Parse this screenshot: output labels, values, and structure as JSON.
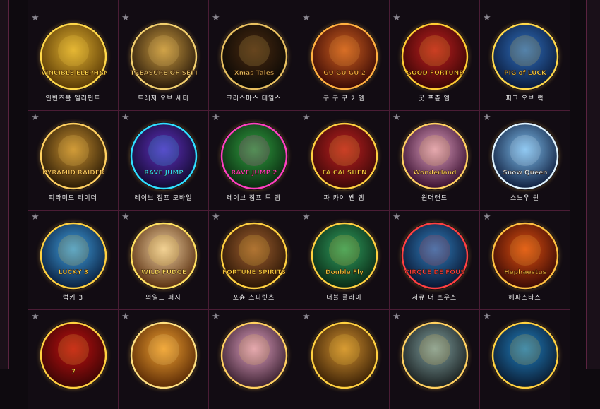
{
  "rows": [
    {
      "games": [
        {
          "name": "",
          "art": "",
          "c1": "#3a2a1a",
          "c2": "#1a1410",
          "accent": "#c9a050"
        },
        {
          "name": "",
          "art": "",
          "c1": "#3a2a1a",
          "c2": "#1a1410",
          "accent": "#c9a050"
        },
        {
          "name": "",
          "art": "",
          "c1": "#3a2a1a",
          "c2": "#1a1410",
          "accent": "#c9a050"
        },
        {
          "name": "",
          "art": "",
          "c1": "#3a2a1a",
          "c2": "#1a1410",
          "accent": "#c9a050"
        },
        {
          "name": "",
          "art": "",
          "c1": "#3a2a1a",
          "c2": "#1a1410",
          "accent": "#c9a050"
        },
        {
          "name": "",
          "art": "",
          "c1": "#3a2a1a",
          "c2": "#1a1410",
          "accent": "#c9a050"
        }
      ]
    },
    {
      "games": [
        {
          "name": "인빈츠블 엘러펀트",
          "art": "INVINCIBLE ELEPHANT",
          "c1": "#e0b030",
          "c2": "#5a3a05",
          "accent": "#ffd84a"
        },
        {
          "name": "트레져 오브 세티",
          "art": "TREASURE OF SETI",
          "c1": "#c99a40",
          "c2": "#2a1a0a",
          "accent": "#f2cf6e"
        },
        {
          "name": "크리스마스 테일스",
          "art": "Xmas Tales",
          "c1": "#4a2a10",
          "c2": "#0a0805",
          "accent": "#e8c060"
        },
        {
          "name": "구 구 구 2 엠",
          "art": "GU GU GU 2",
          "c1": "#d06020",
          "c2": "#3a0a05",
          "accent": "#ffb040"
        },
        {
          "name": "굿 포츈 엠",
          "art": "GOOD FORTUNE",
          "c1": "#c02020",
          "c2": "#3a0505",
          "accent": "#ffcc33"
        },
        {
          "name": "피그 오브 럭",
          "art": "PIG of LUCK",
          "c1": "#3070c0",
          "c2": "#0a1a3a",
          "accent": "#ffd84a"
        }
      ]
    },
    {
      "games": [
        {
          "name": "피라미드 라이더",
          "art": "PYRAMID RAIDER",
          "c1": "#c89030",
          "c2": "#2a1a05",
          "accent": "#ffd060"
        },
        {
          "name": "레이브 점프 모바일",
          "art": "RAVE JUMP",
          "c1": "#6030c0",
          "c2": "#120a30",
          "accent": "#30e0ff"
        },
        {
          "name": "레이브 점프 투 엠",
          "art": "RAVE JUMP 2",
          "c1": "#30a040",
          "c2": "#0a2a10",
          "accent": "#ff40c0"
        },
        {
          "name": "파 카이 쎈 엠",
          "art": "FA CAI SHEN",
          "c1": "#c02020",
          "c2": "#3a0808",
          "accent": "#ffd040"
        },
        {
          "name": "원더랜드",
          "art": "Wonderland",
          "c1": "#e0a0c0",
          "c2": "#3a1030",
          "accent": "#ffd060"
        },
        {
          "name": "스노우 퀸",
          "art": "Snow Queen",
          "c1": "#80c0f0",
          "c2": "#102040",
          "accent": "#e0f4ff"
        }
      ]
    },
    {
      "games": [
        {
          "name": "럭키 3",
          "art": "LUCKY 3",
          "c1": "#40a0e0",
          "c2": "#0a2040",
          "accent": "#ffd040"
        },
        {
          "name": "와일드 퍼지",
          "art": "WILD FUDGE",
          "c1": "#f0d0a0",
          "c2": "#5a3010",
          "accent": "#ffe060"
        },
        {
          "name": "포츈 스피릿츠",
          "art": "FORTUNE SPIRITS",
          "c1": "#a06030",
          "c2": "#2a1505",
          "accent": "#ffd040"
        },
        {
          "name": "더블 플라이",
          "art": "Double Fly",
          "c1": "#30a060",
          "c2": "#0a2a15",
          "accent": "#ffd040"
        },
        {
          "name": "서큐 더 포우스",
          "art": "CIRQUE DE FOUS",
          "c1": "#3080c0",
          "c2": "#0a1530",
          "accent": "#ff4040"
        },
        {
          "name": "헤파스타스",
          "art": "Hephaestus",
          "c1": "#e05010",
          "c2": "#3a0a05",
          "accent": "#ffc040"
        }
      ]
    },
    {
      "games": [
        {
          "name": "",
          "art": "7",
          "c1": "#c01010",
          "c2": "#3a0505",
          "accent": "#ffd040"
        },
        {
          "name": "",
          "art": "",
          "c1": "#f0a030",
          "c2": "#5a2a05",
          "accent": "#ffe080"
        },
        {
          "name": "",
          "art": "",
          "c1": "#e0a0c0",
          "c2": "#3a2030",
          "accent": "#ffd060"
        },
        {
          "name": "",
          "art": "",
          "c1": "#d09030",
          "c2": "#3a2005",
          "accent": "#ffd040"
        },
        {
          "name": "",
          "art": "",
          "c1": "#80a0a0",
          "c2": "#1a2020",
          "accent": "#ffd060"
        },
        {
          "name": "",
          "art": "",
          "c1": "#2080c0",
          "c2": "#0a1a30",
          "accent": "#ffd040"
        }
      ]
    }
  ]
}
